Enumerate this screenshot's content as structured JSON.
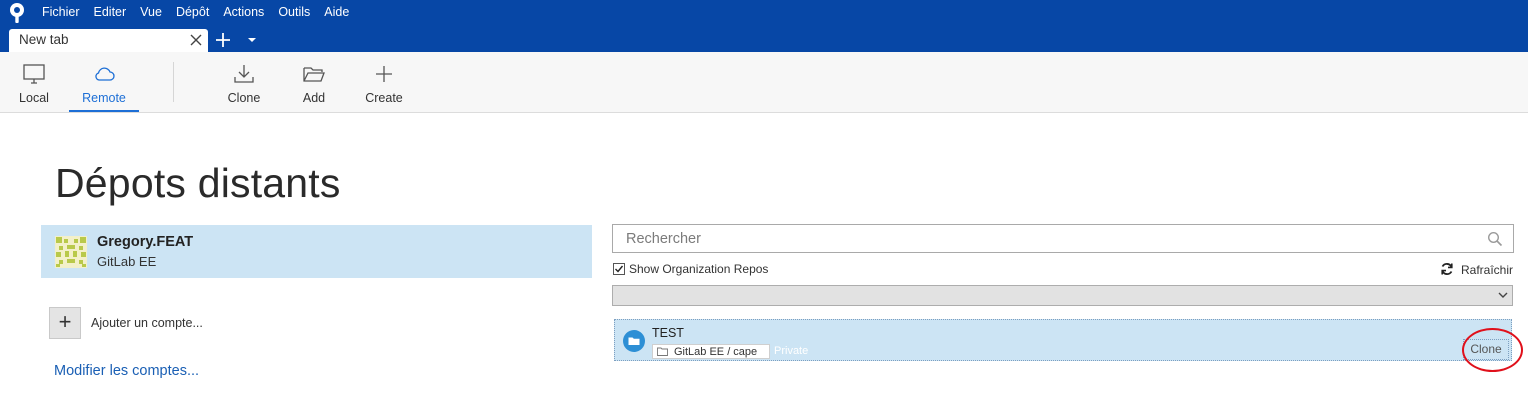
{
  "app": {
    "menu": [
      "Fichier",
      "Editer",
      "Vue",
      "Dépôt",
      "Actions",
      "Outils",
      "Aide"
    ]
  },
  "tabs": [
    {
      "label": "New tab"
    }
  ],
  "toolbar": {
    "local_label": "Local",
    "remote_label": "Remote",
    "clone_label": "Clone",
    "add_label": "Add",
    "create_label": "Create"
  },
  "page": {
    "title": "Dépots distants"
  },
  "accounts": {
    "items": [
      {
        "name": "Gregory.FEAT",
        "provider": "GitLab EE"
      }
    ],
    "add_label": "Ajouter un compte...",
    "edit_link": "Modifier les comptes..."
  },
  "repos_panel": {
    "search_placeholder": "Rechercher",
    "show_org_label": "Show Organization Repos",
    "show_org_checked": true,
    "refresh_label": "Rafraîchir",
    "filter_value": "",
    "repos": [
      {
        "name": "TEST",
        "path": "GitLab EE / cape",
        "visibility": "Private",
        "clone_label": "Clone"
      }
    ]
  },
  "colors": {
    "titlebar": "#0747a6",
    "accent": "#1d6fd6",
    "selection": "#cce4f4",
    "highlight_ring": "#e0101b"
  }
}
